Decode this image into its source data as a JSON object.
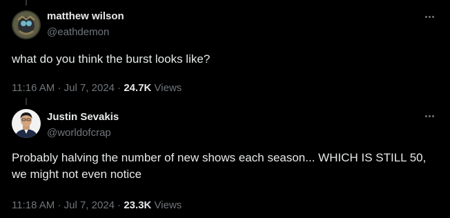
{
  "tweets": [
    {
      "author_name": "matthew wilson",
      "handle": "@eathdemon",
      "text": "what do you think the burst looks like?",
      "time": "11:16 AM",
      "date": "Jul 7, 2024",
      "views_count": "24.7K",
      "views_label": "Views",
      "more_icon": "more-horizontal-icon"
    },
    {
      "author_name": "Justin Sevakis",
      "handle": "@worldofcrap",
      "text": "Probably halving the number of new shows each season... WHICH IS STILL 50, we might not even notice",
      "time": "11:18 AM",
      "date": "Jul 7, 2024",
      "views_count": "23.3K",
      "views_label": "Views",
      "more_icon": "more-horizontal-icon"
    }
  ],
  "separator": "·",
  "colors": {
    "background": "#000000",
    "primary_text": "#e7e9ea",
    "secondary_text": "#71767b",
    "thread_line": "#333639"
  }
}
